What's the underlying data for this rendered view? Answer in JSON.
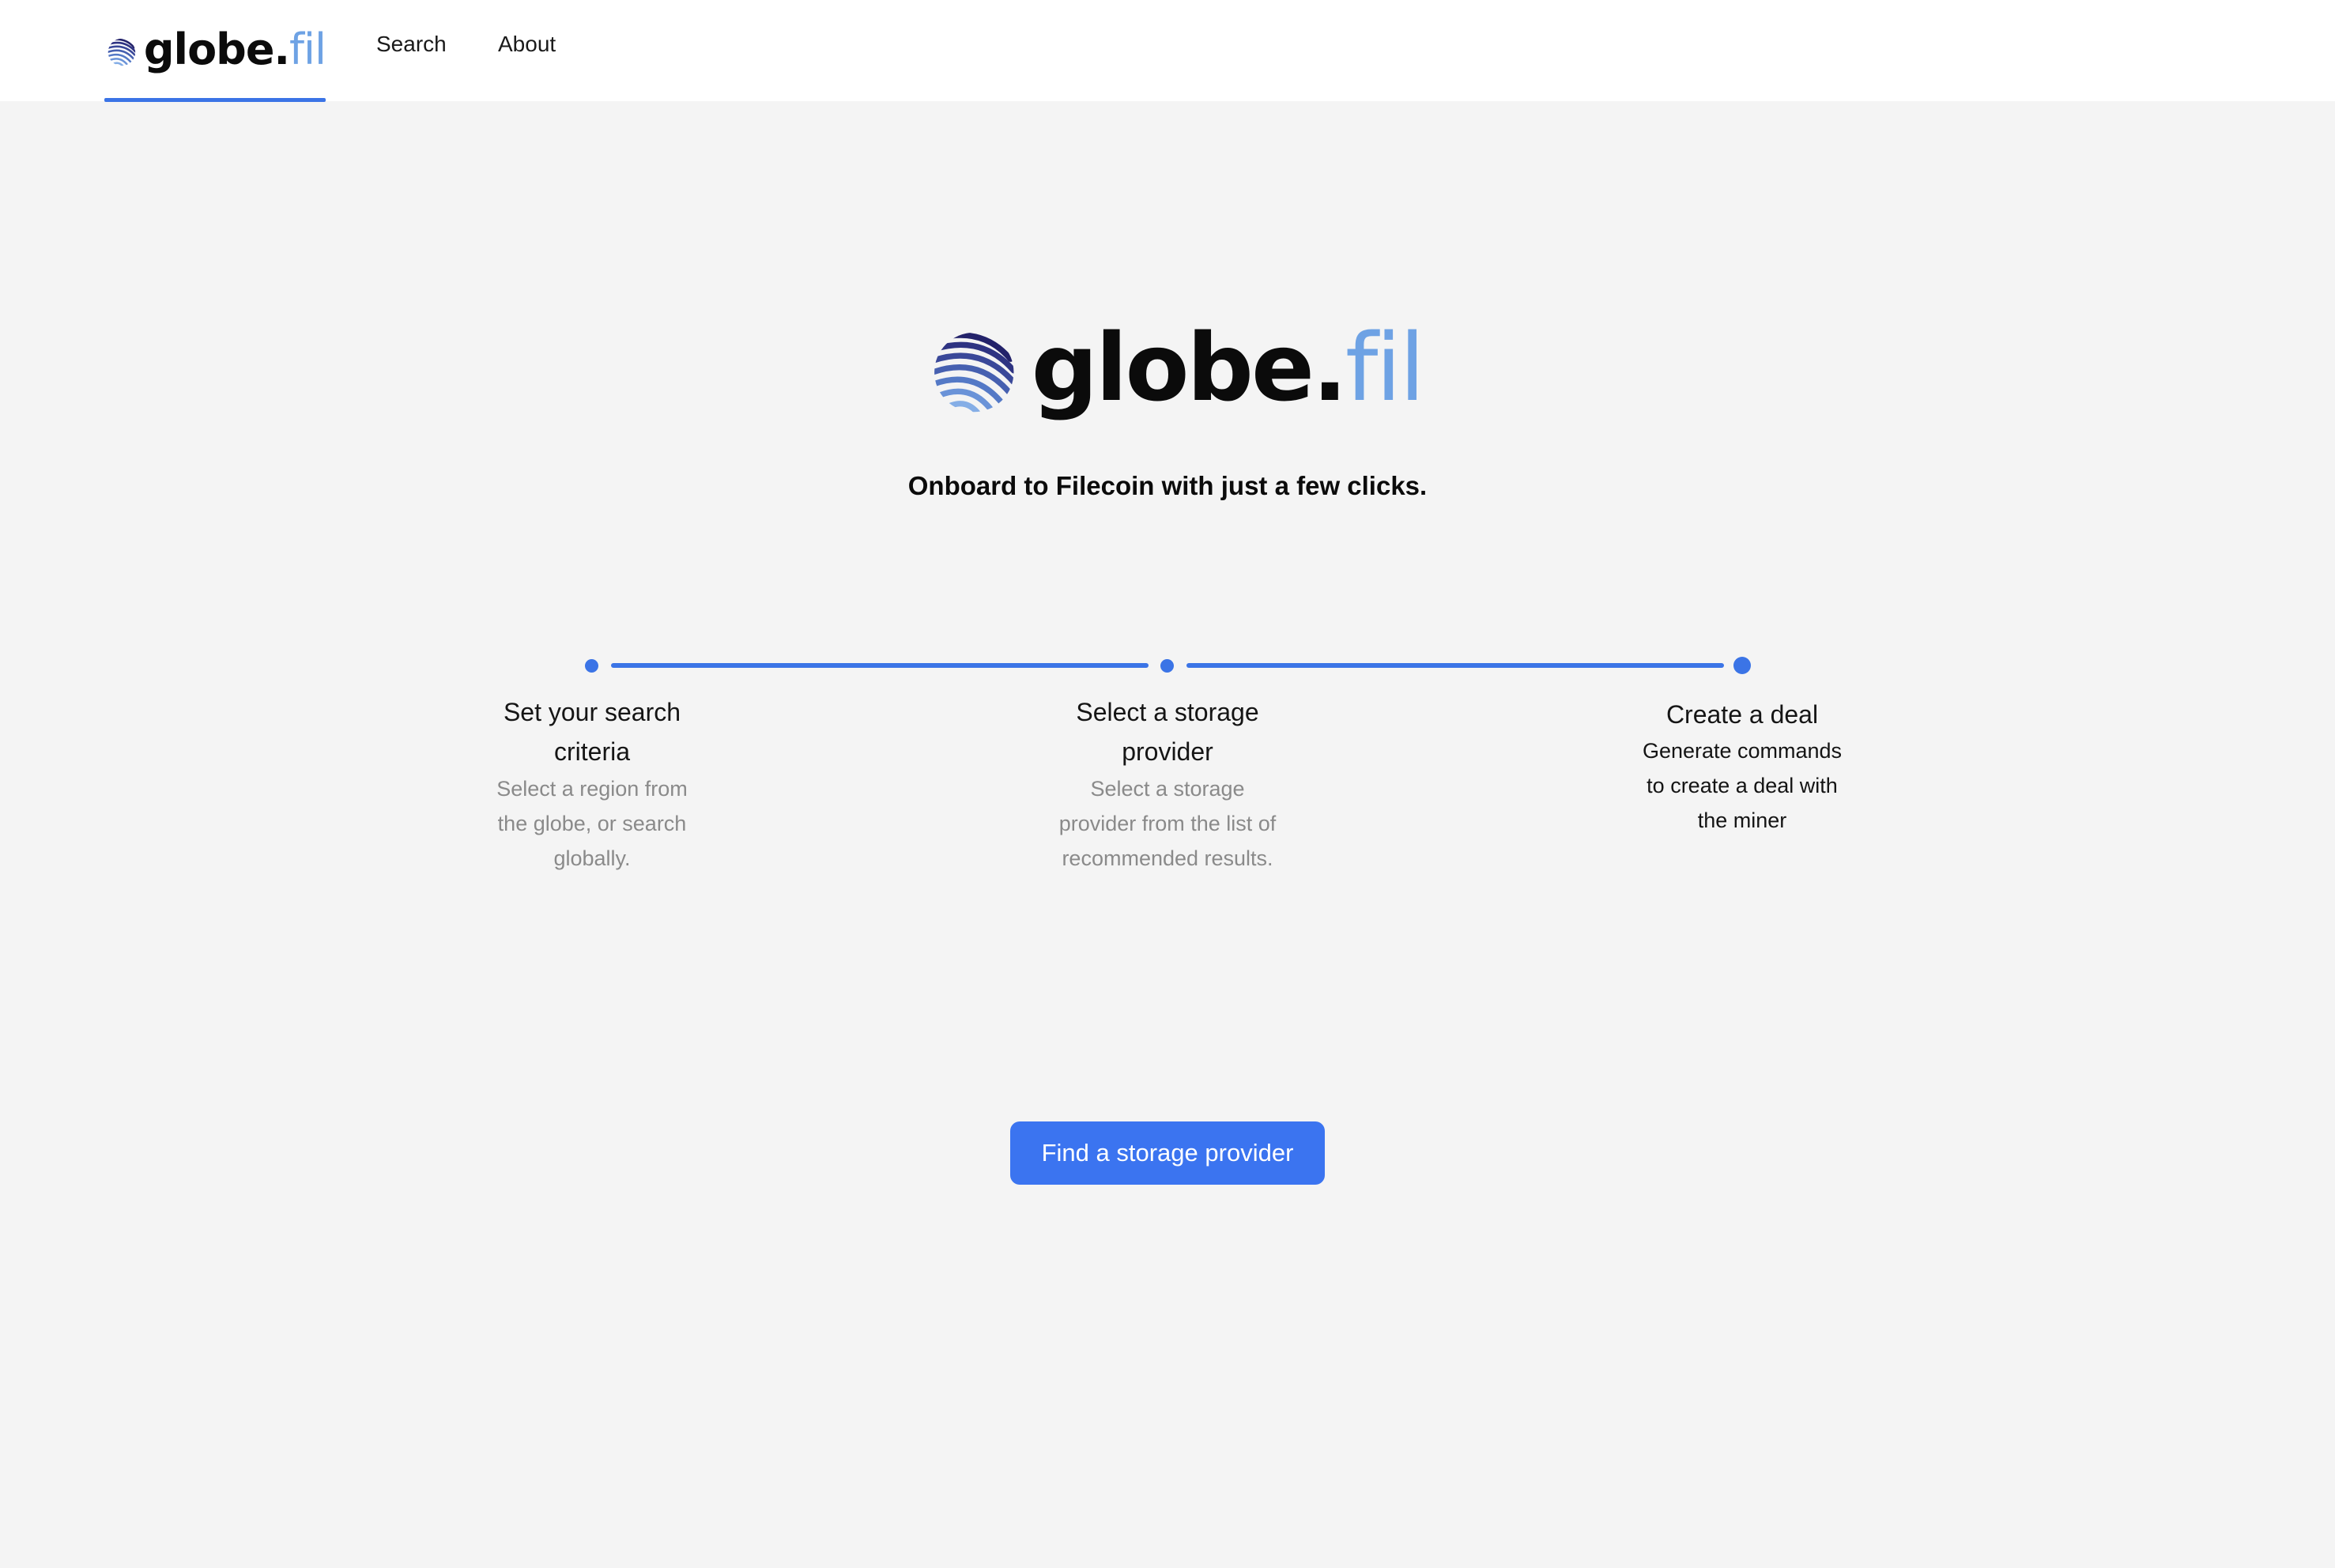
{
  "nav": {
    "brand": {
      "word": "globe.",
      "accent": "fil"
    },
    "links": [
      {
        "label": "Search"
      },
      {
        "label": "About"
      }
    ],
    "active_item": "brand"
  },
  "hero": {
    "brand": {
      "word": "globe.",
      "accent": "fil"
    },
    "tagline": "Onboard to Filecoin with just a few clicks."
  },
  "steps": [
    {
      "title": "Set your search criteria",
      "description": "Select a region from the globe, or search globally."
    },
    {
      "title": "Select a storage provider",
      "description": "Select a storage provider from the list of recommended results."
    },
    {
      "title": "Create a deal",
      "description": "Generate commands to create a deal with the miner"
    }
  ],
  "cta": {
    "label": "Find a storage provider"
  },
  "colors": {
    "accent": "#3b74e6",
    "brand_light": "#6ea2e4",
    "logo_dark": "#2b2f7e",
    "background": "#f4f4f4",
    "nav_background": "#ffffff"
  },
  "icons": {
    "logo": "striped-globe-icon"
  }
}
